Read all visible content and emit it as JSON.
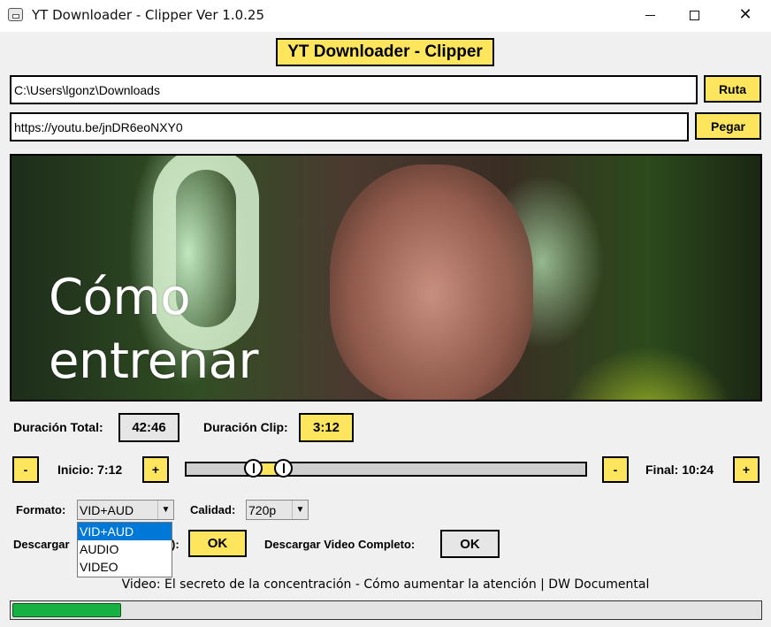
{
  "window": {
    "title": "YT Downloader - Clipper Ver 1.0.25",
    "controls": [
      "minimize-icon",
      "maximize-icon",
      "close-icon"
    ]
  },
  "header": {
    "label": "YT Downloader - Clipper"
  },
  "path": {
    "value": "C:\\Users\\lgonz\\Downloads",
    "button": "Ruta"
  },
  "url": {
    "value": "https://youtu.be/jnDR6eoNXY0",
    "button": "Pegar"
  },
  "thumbnail": {
    "line1": "Cómo",
    "line2": "entrenar"
  },
  "duration": {
    "total_label": "Duración Total:",
    "total_value": "42:46",
    "clip_label": "Duración Clip:",
    "clip_value": "3:12"
  },
  "trim": {
    "minus": "-",
    "plus": "+",
    "start_label": "Inicio: 7:12",
    "end_label": "Final: 10:24",
    "start_fraction": 0.1684,
    "end_fraction": 0.2432
  },
  "format": {
    "label": "Formato:",
    "value": "VID+AUD",
    "options": [
      "VID+AUD",
      "AUDIO",
      "VIDEO"
    ],
    "selected_index": 0
  },
  "quality": {
    "label": "Calidad:",
    "value": "720p"
  },
  "download": {
    "clip_label": "Descargar",
    "clip_label_tail": "):",
    "clip_button": "OK",
    "full_label": "Descargar Video Completo:",
    "full_button": "OK"
  },
  "status": {
    "video_title": "Video: El secreto de la concentración - Cómo aumentar la atención | DW Documental",
    "progress_fraction": 0.145
  },
  "colors": {
    "accent_yellow": "#fde65e",
    "progress_green": "#16b043",
    "selection_blue": "#0078d7"
  }
}
